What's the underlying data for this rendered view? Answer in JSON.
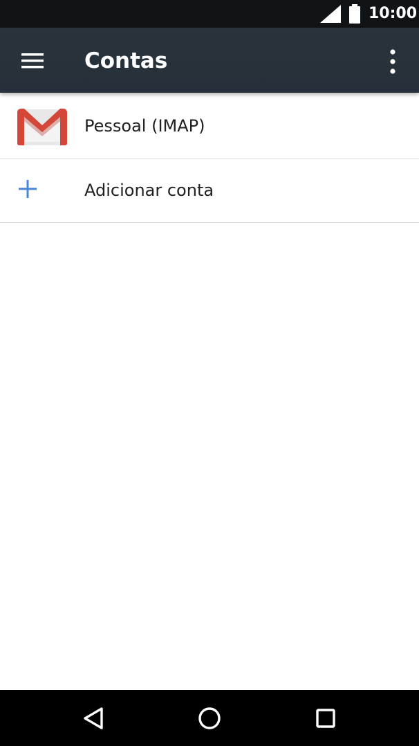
{
  "status_bar": {
    "time": "10:00",
    "signal_icon": "cellular-signal-icon",
    "battery_icon": "battery-full-icon"
  },
  "toolbar": {
    "title": "Contas",
    "menu_icon": "hamburger-menu-icon",
    "overflow_icon": "more-vert-icon"
  },
  "accounts": {
    "items": [
      {
        "label": "Pessoal (IMAP)",
        "icon": "gmail-icon"
      }
    ],
    "add_account": {
      "label": "Adicionar conta",
      "icon": "plus-icon"
    }
  },
  "nav_bar": {
    "back_icon": "back-triangle-icon",
    "home_icon": "home-circle-icon",
    "recents_icon": "recents-square-icon"
  },
  "colors": {
    "toolbar": "#2a333b",
    "status_bar": "#111416",
    "accent_blue": "#4a86d8",
    "gmail_red": "#d44638"
  }
}
